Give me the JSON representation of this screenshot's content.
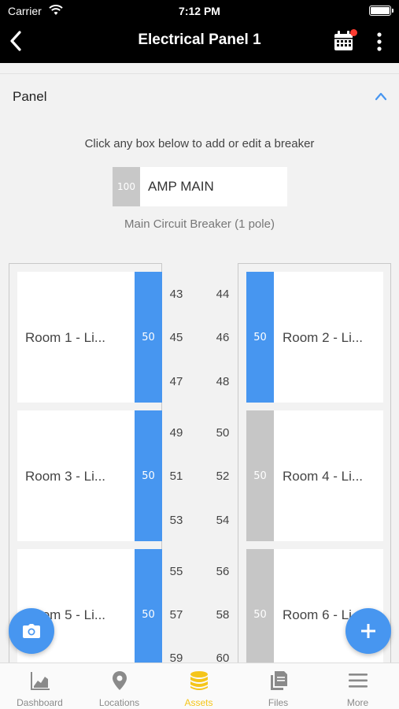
{
  "status_bar": {
    "carrier": "Carrier",
    "time": "7:12 PM"
  },
  "nav": {
    "title": "Electrical Panel 1"
  },
  "panel": {
    "header": "Panel",
    "instruction": "Click any box below to add or edit a breaker",
    "main": {
      "amp": "100",
      "label": "AMP MAIN",
      "subtitle": "Main Circuit Breaker (1 pole)"
    }
  },
  "breakers_left": [
    {
      "room": "Room 1 - Li...",
      "amps": "50",
      "state": "on"
    },
    {
      "room": "Room 3 - Li...",
      "amps": "50",
      "state": "on"
    },
    {
      "room": "Room 5 - Li...",
      "amps": "50",
      "state": "on"
    }
  ],
  "breakers_right": [
    {
      "room": "Room 2 - Li...",
      "amps": "50",
      "state": "on"
    },
    {
      "room": "Room 4 - Li...",
      "amps": "50",
      "state": "off"
    },
    {
      "room": "Room 6 - Li...",
      "amps": "50",
      "state": "off"
    }
  ],
  "slot_numbers_left": [
    "43",
    "45",
    "47",
    "49",
    "51",
    "53",
    "55",
    "57",
    "59"
  ],
  "slot_numbers_right": [
    "44",
    "46",
    "48",
    "50",
    "52",
    "54",
    "56",
    "58",
    "60"
  ],
  "tabs": [
    {
      "label": "Dashboard",
      "icon": "chart-icon"
    },
    {
      "label": "Locations",
      "icon": "location-pin-icon"
    },
    {
      "label": "Assets",
      "icon": "coins-stack-icon",
      "active": true
    },
    {
      "label": "Files",
      "icon": "files-icon"
    },
    {
      "label": "More",
      "icon": "menu-icon"
    }
  ],
  "colors": {
    "accent": "#4796f0",
    "breaker_off": "#c6c6c6",
    "active_tab": "#f5c519",
    "badge": "#ff3b30"
  }
}
